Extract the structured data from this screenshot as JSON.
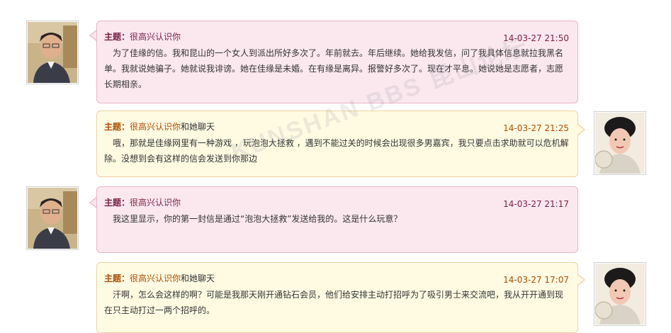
{
  "topic_prefix": "主题：",
  "messages": [
    {
      "side": "left",
      "topic_link": "很高兴认识你",
      "topic_extra": "",
      "time": "14-03-27 21:50",
      "body": "为了佳缘的信。我和昆山的一个女人到派出所好多次了。年前就去。年后继续。她给我发信，问了我具体信息就拉我黑名单。我就说她骗子。她就说我诽谤。她在佳缘是未婚。在有缘是离异。报警好多次了。现在才平息。她说她是志愿者，志愿长期相亲。"
    },
    {
      "side": "right",
      "topic_link": "很高兴认识你",
      "topic_extra": "和她聊天",
      "time": "14-03-27 21:25",
      "body": "哦，那就是佳缘网里有一种游戏 ，玩泡泡大拯救 ，遇到不能过关的时候会出现很多男嘉宾，我只要点击求助就可以危机解除。没想到会有这样的信会发送到你那边"
    },
    {
      "side": "left",
      "topic_link": "很高兴认识你",
      "topic_extra": "",
      "time": "14-03-27 21:17",
      "body": "我这里显示，你的第一封信是通过“泡泡大拯救”发送给我的。这是什么玩意？"
    },
    {
      "side": "right",
      "topic_link": "很高兴认识你",
      "topic_extra": "和她聊天",
      "time": "14-03-27 17:07",
      "body": "汗啊，怎么会这样的啊？可能是我那天刚开通钻石会员，他们给安排主动打招呼为了吸引男士来交流吧，我从开开通到现在只主动打过一两个招呼的。"
    }
  ],
  "watermark": "KUNSHAN BBS 昆山论坛",
  "colors": {
    "left_bubble_bg": "#fbe8ee",
    "left_bubble_border": "#e7b5c5",
    "right_bubble_bg": "#fffbe3",
    "right_bubble_border": "#eed39b",
    "topic_left": "#7a1e42",
    "topic_right": "#b04a00"
  }
}
